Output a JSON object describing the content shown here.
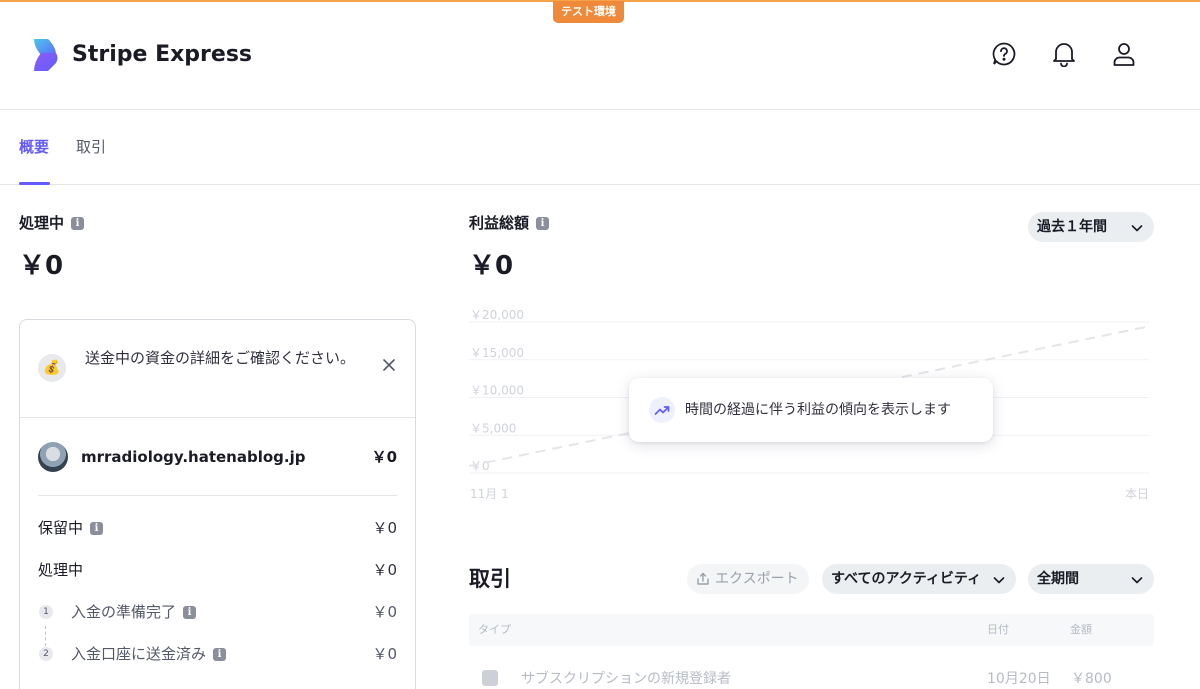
{
  "env_badge": "テスト環境",
  "header": {
    "brand": "Stripe Express"
  },
  "tabs": [
    {
      "label": "概要",
      "active": true
    },
    {
      "label": "取引",
      "active": false
    }
  ],
  "processing": {
    "label": "処理中",
    "amount": "￥0"
  },
  "notice": {
    "text": "送金中の資金の詳細をご確認ください。"
  },
  "account": {
    "name": "mrradiology.hatenablog.jp",
    "amount": "￥0"
  },
  "rows": {
    "on_hold_label": "保留中",
    "on_hold_amount": "￥0",
    "processing_label": "処理中",
    "processing_amount": "￥0"
  },
  "steps": [
    {
      "num": "1",
      "label": "入金の準備完了",
      "amount": "￥0"
    },
    {
      "num": "2",
      "label": "入金口座に送金済み",
      "amount": "￥0"
    }
  ],
  "revenue": {
    "label": "利益総額",
    "amount": "￥0",
    "period": "過去１年間"
  },
  "chart_data": {
    "type": "line",
    "title": "",
    "xlabel": "",
    "ylabel": "",
    "y_ticks": [
      "￥20,000",
      "￥15,000",
      "￥10,000",
      "￥5,000",
      "￥0"
    ],
    "x_ticks": [
      "11月 1",
      "本日"
    ],
    "ylim": [
      0,
      20000
    ],
    "series": [
      {
        "x": [
          "11月 1",
          "本日"
        ],
        "values": [
          0,
          18500
        ]
      }
    ],
    "grid": true,
    "overlay_text": "時間の経過に伴う利益の傾向を表示します"
  },
  "transactions": {
    "title": "取引",
    "export_label": "エクスポート",
    "activity_filter": "すべてのアクティビティ",
    "period_filter": "全期間",
    "columns": {
      "type": "タイプ",
      "date": "日付",
      "amount": "金額"
    },
    "rows": [
      {
        "type": "サブスクリプションの新規登録者",
        "date": "10月20日",
        "amount": "￥800"
      }
    ]
  },
  "colors": {
    "accent": "#635bff",
    "env_badge": "#ef8a3a"
  }
}
